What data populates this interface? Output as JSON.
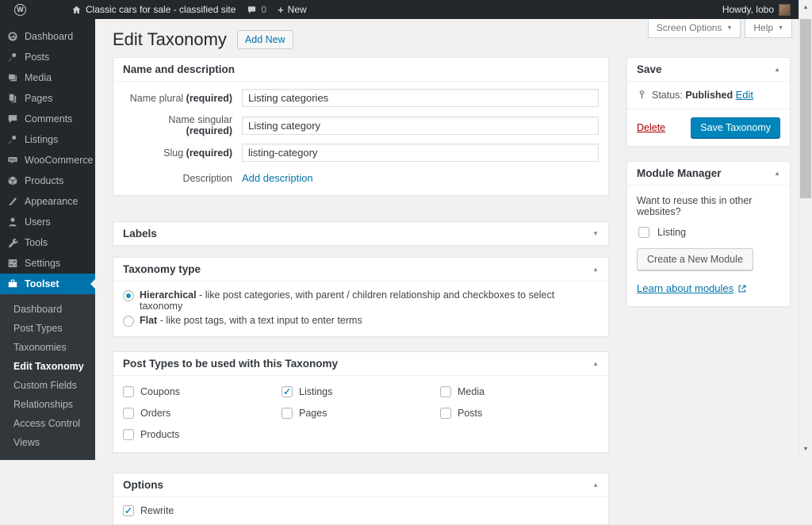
{
  "adminbar": {
    "site_title": "Classic cars for sale - classified site",
    "comments_count": "0",
    "new_label": "New",
    "howdy": "Howdy, lobo"
  },
  "icons": {
    "wp": "W",
    "plus": "+",
    "up": "▲",
    "down": "▼",
    "check": "✓"
  },
  "sidebar": {
    "items": [
      {
        "label": "Dashboard"
      },
      {
        "label": "Posts"
      },
      {
        "label": "Media"
      },
      {
        "label": "Pages"
      },
      {
        "label": "Comments"
      },
      {
        "label": "Listings"
      },
      {
        "label": "WooCommerce"
      },
      {
        "label": "Products"
      },
      {
        "label": "Appearance"
      },
      {
        "label": "Users"
      },
      {
        "label": "Tools"
      },
      {
        "label": "Settings"
      },
      {
        "label": "Toolset"
      }
    ],
    "active_item": "Toolset",
    "submenu": [
      {
        "label": "Dashboard"
      },
      {
        "label": "Post Types"
      },
      {
        "label": "Taxonomies"
      },
      {
        "label": "Edit Taxonomy",
        "current": true
      },
      {
        "label": "Custom Fields"
      },
      {
        "label": "Relationships"
      },
      {
        "label": "Access Control"
      },
      {
        "label": "Views"
      }
    ]
  },
  "header": {
    "title": "Edit Taxonomy",
    "add_new": "Add New",
    "screen_options": "Screen Options",
    "help": "Help"
  },
  "panels": {
    "name_desc": {
      "title": "Name and description",
      "fields": [
        {
          "label": "Name plural",
          "required": "(required)",
          "value": "Listing categories"
        },
        {
          "label": "Name singular",
          "required": "(required)",
          "value": "Listing category"
        },
        {
          "label": "Slug",
          "required": "(required)",
          "value": "listing-category"
        }
      ],
      "description_label": "Description",
      "add_description": "Add description"
    },
    "labels": {
      "title": "Labels"
    },
    "taxonomy_type": {
      "title": "Taxonomy type",
      "options": [
        {
          "name": "Hierarchical",
          "desc": "- like post categories, with parent / children relationship and checkboxes to select taxonomy",
          "selected": true
        },
        {
          "name": "Flat",
          "desc": "- like post tags, with a text input to enter terms",
          "selected": false
        }
      ]
    },
    "post_types": {
      "title": "Post Types to be used with this Taxonomy",
      "checkboxes": [
        {
          "label": "Coupons",
          "checked": false
        },
        {
          "label": "Listings",
          "checked": true
        },
        {
          "label": "Media",
          "checked": false
        },
        {
          "label": "Orders",
          "checked": false
        },
        {
          "label": "Pages",
          "checked": false
        },
        {
          "label": "Posts",
          "checked": false
        },
        {
          "label": "Products",
          "checked": false
        }
      ]
    },
    "options": {
      "title": "Options",
      "first_option": "Rewrite",
      "first_checked": true
    }
  },
  "save_box": {
    "title": "Save",
    "status_label": "Status:",
    "status_value": "Published",
    "edit_link": "Edit",
    "delete_link": "Delete",
    "save_button": "Save Taxonomy"
  },
  "module_manager": {
    "title": "Module Manager",
    "question": "Want to reuse this in other websites?",
    "checkbox_label": "Listing",
    "create_button": "Create a New Module",
    "learn_link": "Learn about modules"
  },
  "colors": {
    "accent_blue": "#0085ba",
    "link_blue": "#0073aa",
    "delete_red": "#a00",
    "admin_dark": "#23282d",
    "submenu_dark": "#32373c",
    "active_blue": "#0073aa"
  }
}
